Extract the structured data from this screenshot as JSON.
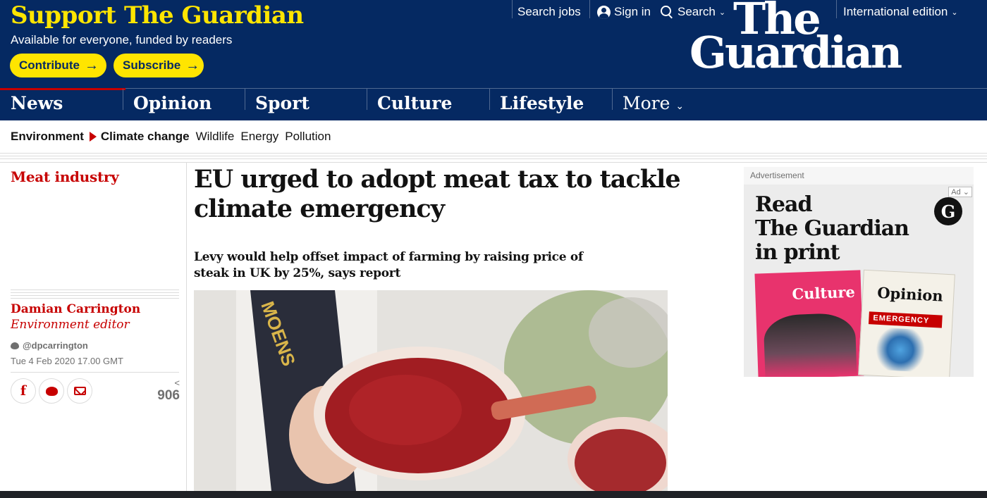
{
  "support": {
    "title": "Support The Guardian",
    "subtitle": "Available for everyone, funded by readers",
    "contribute": "Contribute",
    "subscribe": "Subscribe",
    "arrow": "→"
  },
  "top_links": {
    "search_jobs": "Search jobs",
    "sign_in": "Sign in",
    "search": "Search",
    "edition": "International edition",
    "chevron": "⌄"
  },
  "logo": {
    "line1": "The",
    "line2": "Guardian"
  },
  "nav": {
    "items": [
      "News",
      "Opinion",
      "Sport",
      "Culture",
      "Lifestyle"
    ],
    "more": "More",
    "chevron": "⌄",
    "active": "News",
    "active_color": "#c70000"
  },
  "subnav": {
    "pillar": "Environment",
    "current": "Climate change",
    "links": [
      "Wildlife",
      "Energy",
      "Pollution"
    ]
  },
  "article": {
    "kicker": "Meat industry",
    "headline": "EU urged to adopt meat tax to tackle climate emergency",
    "standfirst": "Levy would help offset impact of farming by raising price of steak in UK by 25%, says report",
    "author": "Damian Carrington",
    "role": "Environment editor",
    "twitter": "@dpcarrington",
    "date": "Tue 4 Feb 2020 17.00 GMT",
    "share_count": "906",
    "share_icon": "share-icon",
    "photo_alt": "Butcher holding a raw steak"
  },
  "ad": {
    "label": "Advertisement",
    "badge": "Ad",
    "chevron": "⌄",
    "title_lines": [
      "Read",
      "The Guardian",
      "in print"
    ],
    "roundel": "G",
    "mag_culture": "Culture",
    "mag_opinion": "Opinion",
    "mag_banner": "EMERGENCY"
  },
  "colors": {
    "brand_blue": "#052962",
    "brand_yellow": "#ffe500",
    "news_red": "#c70000"
  }
}
